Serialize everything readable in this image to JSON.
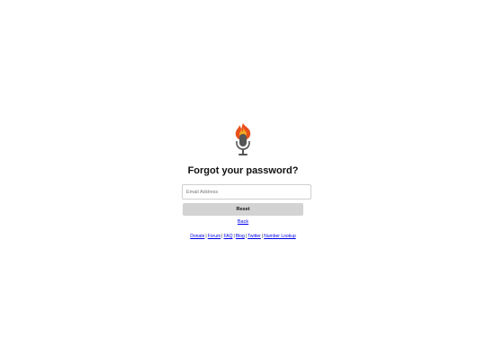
{
  "page": {
    "title": "Forgot your password?",
    "email_placeholder": "Email Address",
    "email_value": "",
    "reset_label": "Reset",
    "back_label": "Back"
  },
  "logo": {
    "icon": "flaming-microphone-icon",
    "flame_color": "#e8501c",
    "flame_inner_color": "#f5a623",
    "mic_color": "#555555"
  },
  "footer": {
    "links": [
      "Donate",
      "Forum",
      "FAQ",
      "Blog",
      "Twitter",
      "Number Lookup"
    ],
    "separator": "|"
  },
  "colors": {
    "link": "#0000ee",
    "button_bg": "#d3d3d3"
  }
}
